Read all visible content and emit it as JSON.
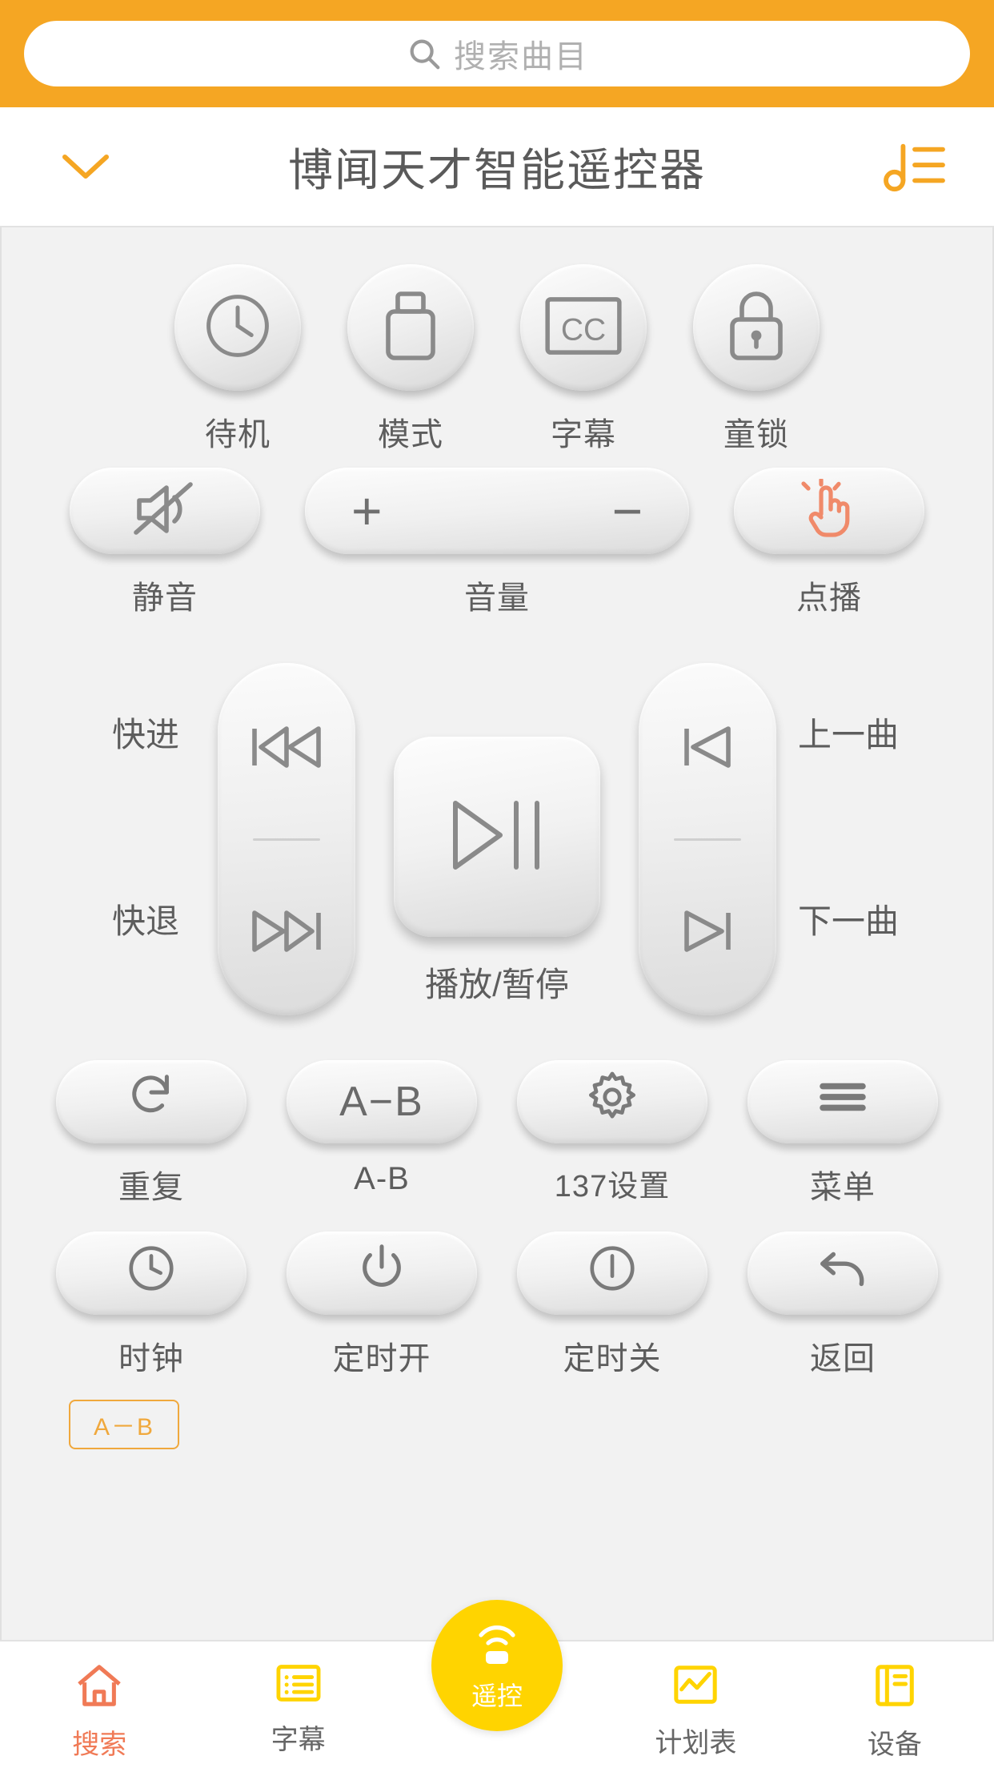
{
  "search": {
    "placeholder": "搜索曲目",
    "icon": "search-icon"
  },
  "header": {
    "title": "博闻天才智能遥控器",
    "collapse_icon": "chevron-down-icon",
    "playlist_icon": "music-list-icon"
  },
  "remote": {
    "row1": [
      {
        "label": "待机",
        "icon": "clock-power-icon"
      },
      {
        "label": "模式",
        "icon": "usb-icon"
      },
      {
        "label": "字幕",
        "icon": "cc-icon"
      },
      {
        "label": "童锁",
        "icon": "lock-icon"
      }
    ],
    "row2": {
      "mute": {
        "label": "静音",
        "icon": "mute-icon"
      },
      "volume": {
        "label": "音量",
        "plus": "+",
        "minus": "−"
      },
      "ondemand": {
        "label": "点播",
        "icon": "hand-tap-icon"
      }
    },
    "transport": {
      "forward_label": "快进",
      "rewind_label": "快退",
      "prev_label": "上一曲",
      "next_label": "下一曲",
      "play_label": "播放/暂停"
    },
    "grid1": [
      {
        "label": "重复",
        "icon": "repeat-icon"
      },
      {
        "label": "A-B",
        "icon": "ab-text",
        "text": "A−B"
      },
      {
        "label": "137设置",
        "icon": "gear-icon"
      },
      {
        "label": "菜单",
        "icon": "menu-icon"
      }
    ],
    "grid2": [
      {
        "label": "时钟",
        "icon": "clock-icon"
      },
      {
        "label": "定时开",
        "icon": "power-on-icon"
      },
      {
        "label": "定时关",
        "icon": "power-off-icon"
      },
      {
        "label": "返回",
        "icon": "back-arrow-icon"
      }
    ],
    "ab_tag": "A－B"
  },
  "tabs": [
    {
      "label": "搜索",
      "icon": "home-icon",
      "active": true
    },
    {
      "label": "字幕",
      "icon": "subtitle-icon",
      "active": false
    },
    {
      "label": "遥控",
      "icon": "remote-wifi-icon",
      "active": false,
      "center": true
    },
    {
      "label": "计划表",
      "icon": "schedule-icon",
      "active": false
    },
    {
      "label": "设备",
      "icon": "device-book-icon",
      "active": false
    }
  ],
  "colors": {
    "accent_orange": "#f5a623",
    "fab_yellow": "#ffd400",
    "active_tab": "#f07a56",
    "icon_gray": "#7a7a7a"
  }
}
